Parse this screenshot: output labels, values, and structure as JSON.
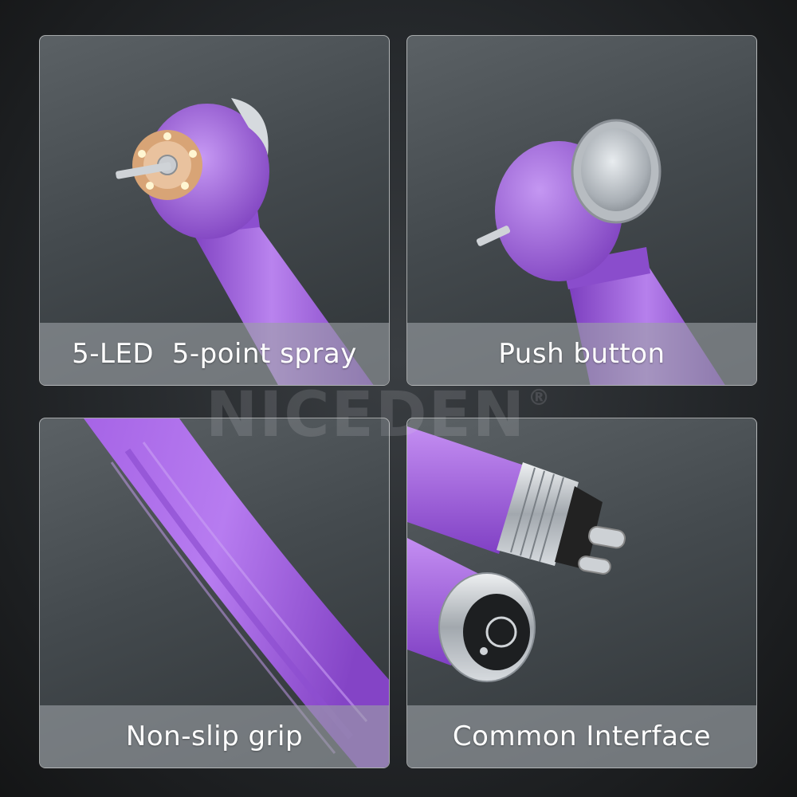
{
  "panels": [
    {
      "caption": "5-LED  5-point spray"
    },
    {
      "caption": "Push button"
    },
    {
      "caption": "Non-slip grip"
    },
    {
      "caption": "Common Interface"
    }
  ],
  "watermark": {
    "brand": "NICEDEN",
    "mark": "®"
  },
  "colors": {
    "handpiece_purple": "#9a5ad8",
    "handpiece_purple_light": "#c08af0",
    "led_ring_copper": "#d19a6a",
    "metal": "#c8cdd2",
    "caption_text": "#ffffff"
  }
}
